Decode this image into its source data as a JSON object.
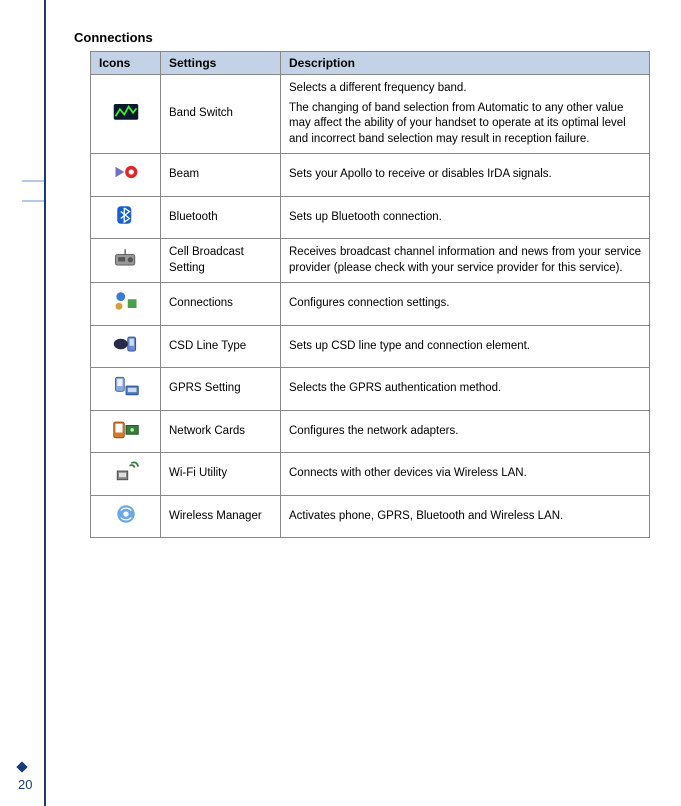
{
  "page_number": "20",
  "section_title": "Connections",
  "table": {
    "headers": {
      "icons": "Icons",
      "settings": "Settings",
      "description": "Description"
    },
    "rows": [
      {
        "icon": "band-switch-icon",
        "setting": "Band Switch",
        "desc_lines": [
          "Selects a different frequency band.",
          "The changing of band selection from Automatic to any other value may affect the ability of your handset to operate at its optimal level and incorrect band selection may result in reception failure."
        ]
      },
      {
        "icon": "beam-icon",
        "setting": "Beam",
        "desc_lines": [
          "Sets your Apollo to receive or disables IrDA signals."
        ]
      },
      {
        "icon": "bluetooth-icon",
        "setting": "Bluetooth",
        "desc_lines": [
          "Sets up Bluetooth connection."
        ]
      },
      {
        "icon": "cell-broadcast-icon",
        "setting": "Cell Broadcast Setting",
        "desc_lines": [
          "Receives broadcast channel information and news from your service provider (please check with your service provider for this service)."
        ],
        "justify": true
      },
      {
        "icon": "connections-icon",
        "setting": "Connections",
        "desc_lines": [
          "Configures connection settings."
        ]
      },
      {
        "icon": "csd-line-icon",
        "setting": "CSD Line Type",
        "desc_lines": [
          "Sets up CSD line type and connection element."
        ]
      },
      {
        "icon": "gprs-icon",
        "setting": "GPRS Setting",
        "desc_lines": [
          "Selects the GPRS authentication method."
        ]
      },
      {
        "icon": "network-cards-icon",
        "setting": "Network Cards",
        "desc_lines": [
          "Configures the network adapters."
        ]
      },
      {
        "icon": "wifi-utility-icon",
        "setting": "Wi-Fi Utility",
        "desc_lines": [
          "Connects with other devices via Wireless LAN."
        ]
      },
      {
        "icon": "wireless-manager-icon",
        "setting": "Wireless Manager",
        "desc_lines": [
          "Activates phone, GPRS, Bluetooth and Wireless LAN."
        ]
      }
    ]
  }
}
